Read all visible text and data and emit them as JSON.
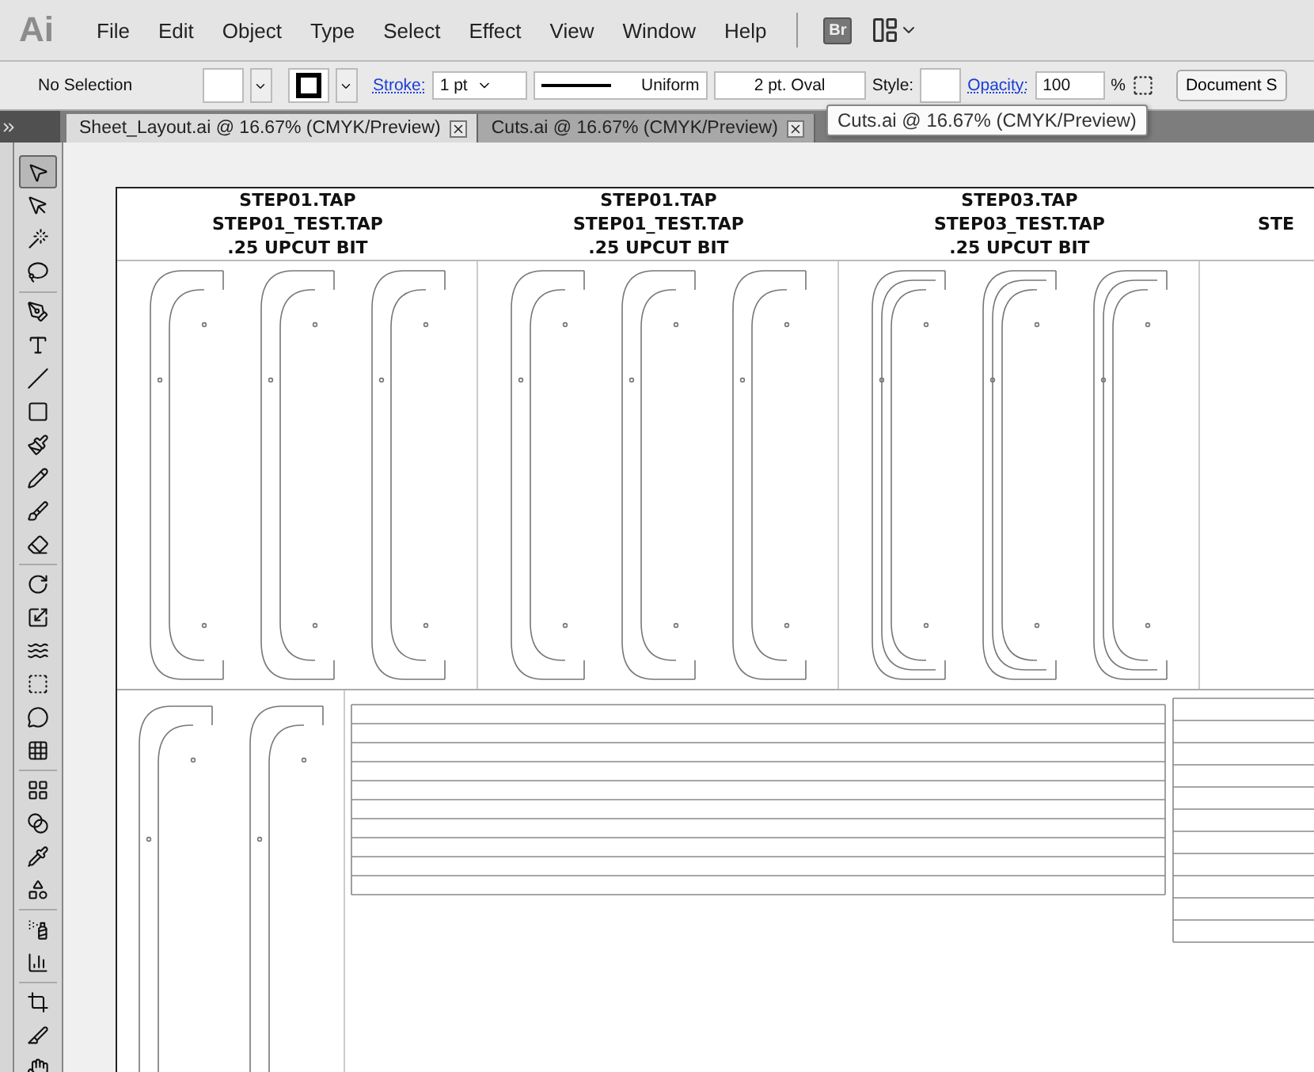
{
  "app": {
    "logo": "Ai"
  },
  "menu": [
    "File",
    "Edit",
    "Object",
    "Type",
    "Select",
    "Effect",
    "View",
    "Window",
    "Help"
  ],
  "bridge_button": "Br",
  "control_bar": {
    "selection": "No Selection",
    "stroke_label": "Stroke:",
    "stroke_weight": "1 pt",
    "profile": "Uniform",
    "brush": "2 pt. Oval",
    "style_label": "Style:",
    "opacity_label": "Opacity:",
    "opacity_value": "100",
    "percent": "%",
    "document_button": "Document S"
  },
  "tabs": [
    {
      "label": "Sheet_Layout.ai @ 16.67% (CMYK/Preview)",
      "selected": true
    },
    {
      "label": "Cuts.ai @ 16.67% (CMYK/Preview)",
      "selected": false
    }
  ],
  "tooltip": "Cuts.ai @ 16.67% (CMYK/Preview)",
  "tools": [
    {
      "selected": true
    },
    {
      "selected": false
    },
    {
      "selected": false
    },
    {
      "selected": false
    },
    {
      "selected": false
    },
    {
      "selected": false
    },
    {
      "selected": false
    },
    {
      "selected": false
    },
    {
      "selected": false
    },
    {
      "selected": false
    },
    {
      "selected": false
    },
    {
      "selected": false
    },
    {
      "selected": false
    },
    {
      "selected": false
    },
    {
      "selected": false
    },
    {
      "selected": false
    },
    {
      "selected": false
    },
    {
      "selected": false
    },
    {
      "selected": false
    },
    {
      "selected": false
    },
    {
      "selected": false
    },
    {
      "selected": false
    },
    {
      "selected": false
    },
    {
      "selected": false
    },
    {
      "selected": false
    },
    {
      "selected": false
    },
    {
      "selected": false
    }
  ],
  "artboard": {
    "headers": [
      {
        "lines": [
          "STEP01.TAP",
          "STEP01_TEST.TAP",
          ".25 UPCUT BIT"
        ]
      },
      {
        "lines": [
          "STEP01.TAP",
          "STEP01_TEST.TAP",
          ".25 UPCUT BIT"
        ]
      },
      {
        "lines": [
          "STEP03.TAP",
          "STEP03_TEST.TAP",
          ".25 UPCUT BIT"
        ]
      },
      {
        "lines": [
          "STE"
        ]
      }
    ]
  }
}
